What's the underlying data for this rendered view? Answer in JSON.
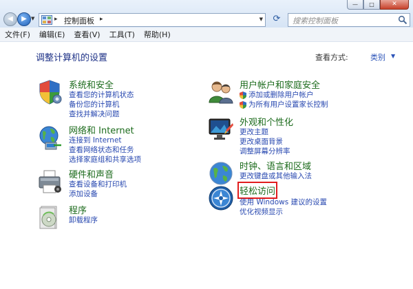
{
  "window": {
    "minimize_glyph": "—",
    "maximize_glyph": "□",
    "close_glyph": "✕"
  },
  "address_bar": {
    "crumb": "控制面板",
    "separator": "▸"
  },
  "search": {
    "placeholder": "搜索控制面板"
  },
  "menu": [
    "文件(F)",
    "编辑(E)",
    "查看(V)",
    "工具(T)",
    "帮助(H)"
  ],
  "content": {
    "title": "调整计算机的设置",
    "view_by_label": "查看方式:",
    "view_by_value": "类别"
  },
  "categories": {
    "system": {
      "title": "系统和安全",
      "icon": "shield-icon",
      "links": [
        "查看您的计算机状态",
        "备份您的计算机",
        "查找并解决问题"
      ]
    },
    "network": {
      "title": "网络和 Internet",
      "icon": "globe-network-icon",
      "links": [
        "连接到 Internet",
        "查看网络状态和任务",
        "选择家庭组和共享选项"
      ]
    },
    "hardware": {
      "title": "硬件和声音",
      "icon": "printer-icon",
      "links": [
        "查看设备和打印机",
        "添加设备"
      ]
    },
    "programs": {
      "title": "程序",
      "icon": "programs-disc-icon",
      "links": [
        "卸载程序"
      ]
    },
    "users": {
      "title": "用户帐户和家庭安全",
      "icon": "users-icon",
      "links": [
        "添加或删除用户帐户",
        "为所有用户设置家长控制"
      ]
    },
    "appearance": {
      "title": "外观和个性化",
      "icon": "monitor-icon",
      "links": [
        "更改主题",
        "更改桌面背景",
        "调整屏幕分辨率"
      ]
    },
    "clock": {
      "title": "时钟、语言和区域",
      "icon": "clock-globe-icon",
      "links": [
        "更改键盘或其他输入法"
      ]
    },
    "ease": {
      "title": "轻松访问",
      "icon": "ease-of-access-icon",
      "links": [
        "使用 Windows 建议的设置",
        "优化视频显示"
      ]
    }
  },
  "colors": {
    "category_title": "#1c6b1c",
    "link": "#2848b0",
    "page_title": "#1e3287",
    "highlight_box": "#e11d1d"
  }
}
